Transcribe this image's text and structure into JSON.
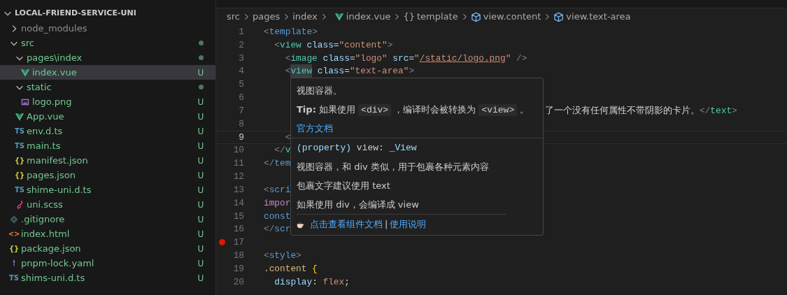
{
  "explorer": {
    "title": "LOCAL-FRIEND-SERVICE-UNI",
    "expanded": true,
    "tree": [
      {
        "label": "node_modules",
        "kind": "folder",
        "expanded": false,
        "dot": false,
        "ignored": true,
        "selected": false
      },
      {
        "label": "src",
        "kind": "folder",
        "expanded": true,
        "dot": true,
        "ignored": false,
        "selected": false,
        "children": [
          {
            "label": "pages\\index",
            "kind": "folder",
            "expanded": true,
            "dot": true,
            "ignored": false,
            "selected": false,
            "children": [
              {
                "label": "index.vue",
                "kind": "vue",
                "badge": "U",
                "ignored": false,
                "selected": true
              }
            ]
          },
          {
            "label": "static",
            "kind": "folder",
            "expanded": true,
            "dot": true,
            "ignored": false,
            "selected": false,
            "children": [
              {
                "label": "logo.png",
                "kind": "image",
                "badge": "U",
                "ignored": false,
                "selected": false
              }
            ]
          },
          {
            "label": "App.vue",
            "kind": "vue",
            "badge": "U",
            "ignored": false,
            "selected": false
          },
          {
            "label": "env.d.ts",
            "kind": "ts",
            "icon_label": "TS",
            "badge": "U",
            "ignored": false,
            "selected": false
          },
          {
            "label": "main.ts",
            "kind": "ts",
            "icon_label": "TS",
            "badge": "U",
            "ignored": false,
            "selected": false
          },
          {
            "label": "manifest.json",
            "kind": "json",
            "icon_label": "{}",
            "badge": "U",
            "ignored": false,
            "selected": false
          },
          {
            "label": "pages.json",
            "kind": "json",
            "icon_label": "{}",
            "badge": "U",
            "ignored": false,
            "selected": false
          },
          {
            "label": "shime-uni.d.ts",
            "kind": "ts",
            "icon_label": "TS",
            "badge": "U",
            "ignored": false,
            "selected": false
          },
          {
            "label": "uni.scss",
            "kind": "scss",
            "badge": "U",
            "ignored": false,
            "selected": false
          }
        ]
      },
      {
        "label": ".gitignore",
        "kind": "git",
        "badge": "U",
        "ignored": false,
        "selected": false
      },
      {
        "label": "index.html",
        "kind": "html",
        "icon_label": "<>",
        "badge": "U",
        "ignored": false,
        "selected": false
      },
      {
        "label": "package.json",
        "kind": "json",
        "icon_label": "{}",
        "badge": "U",
        "ignored": false,
        "selected": false
      },
      {
        "label": "pnpm-lock.yaml",
        "kind": "yaml",
        "icon_label": "!",
        "badge": "U",
        "ignored": false,
        "selected": false
      },
      {
        "label": "shims-uni.d.ts",
        "kind": "ts",
        "icon_label": "TS",
        "badge": "U",
        "ignored": false,
        "selected": false
      }
    ]
  },
  "breadcrumb": [
    {
      "label": "src",
      "kind": "plain"
    },
    {
      "label": "pages",
      "kind": "plain"
    },
    {
      "label": "index",
      "kind": "plain"
    },
    {
      "label": "index.vue",
      "kind": "vue"
    },
    {
      "label": "template",
      "kind": "braces",
      "icon_label": "{}"
    },
    {
      "label": "view.content",
      "kind": "element"
    },
    {
      "label": "view.text-area",
      "kind": "element"
    }
  ],
  "lines": [
    {
      "number": "1",
      "current": false,
      "breakpoint": false,
      "tokens": [
        {
          "text": "<",
          "kind": "punct"
        },
        {
          "text": "template",
          "kind": "tag"
        },
        {
          "text": ">",
          "kind": "punct"
        }
      ]
    },
    {
      "number": "2",
      "current": false,
      "breakpoint": false,
      "tokens": [
        {
          "text": "  <",
          "kind": "punct"
        },
        {
          "text": "view",
          "kind": "comp"
        },
        {
          "text": " class",
          "kind": "attr"
        },
        {
          "text": "=",
          "kind": "plain"
        },
        {
          "text": "\"content\"",
          "kind": "str"
        },
        {
          "text": ">",
          "kind": "punct"
        }
      ]
    },
    {
      "number": "3",
      "current": false,
      "breakpoint": false,
      "tokens": [
        {
          "text": "    <",
          "kind": "punct"
        },
        {
          "text": "image",
          "kind": "comp"
        },
        {
          "text": " class",
          "kind": "attr"
        },
        {
          "text": "=",
          "kind": "plain"
        },
        {
          "text": "\"logo\"",
          "kind": "str"
        },
        {
          "text": " src",
          "kind": "attr"
        },
        {
          "text": "=",
          "kind": "plain"
        },
        {
          "text": "\"",
          "kind": "str"
        },
        {
          "text": "/static/logo.png",
          "kind": "link"
        },
        {
          "text": "\"",
          "kind": "str"
        },
        {
          "text": " />",
          "kind": "punct"
        }
      ]
    },
    {
      "number": "4",
      "current": false,
      "breakpoint": false,
      "tokens": [
        {
          "text": "    <",
          "kind": "punct"
        },
        {
          "text": "view",
          "kind": "comp-hl"
        },
        {
          "text": " class",
          "kind": "attr"
        },
        {
          "text": "=",
          "kind": "plain"
        },
        {
          "text": "\"text-area\"",
          "kind": "str"
        },
        {
          "text": ">",
          "kind": "punct"
        }
      ]
    },
    {
      "number": "5",
      "current": false,
      "breakpoint": false
    },
    {
      "number": "6",
      "current": false,
      "breakpoint": false
    },
    {
      "number": "7",
      "current": false,
      "breakpoint": false,
      "after": [
        {
          "text": "了一个没有任何属性不带阴影的卡片。",
          "kind": "plain"
        },
        {
          "text": "</",
          "kind": "punct"
        },
        {
          "text": "text",
          "kind": "comp"
        },
        {
          "text": ">",
          "kind": "punct"
        }
      ]
    },
    {
      "number": "8",
      "current": false,
      "breakpoint": false
    },
    {
      "number": "9",
      "current": true,
      "breakpoint": false,
      "tokens": [
        {
          "text": "    <",
          "kind": "punct"
        }
      ]
    },
    {
      "number": "10",
      "current": false,
      "breakpoint": false,
      "tokens": [
        {
          "text": "  </",
          "kind": "punct"
        },
        {
          "text": "v",
          "kind": "comp"
        }
      ]
    },
    {
      "number": "11",
      "current": false,
      "breakpoint": false,
      "tokens": [
        {
          "text": "</",
          "kind": "punct"
        },
        {
          "text": "tem",
          "kind": "tag"
        }
      ]
    },
    {
      "number": "12",
      "current": false,
      "breakpoint": false
    },
    {
      "number": "13",
      "current": false,
      "breakpoint": false,
      "tokens": [
        {
          "text": "<",
          "kind": "punct"
        },
        {
          "text": "scri",
          "kind": "tag"
        }
      ]
    },
    {
      "number": "14",
      "current": false,
      "breakpoint": false,
      "tokens": [
        {
          "text": "impor",
          "kind": "keyword"
        }
      ]
    },
    {
      "number": "15",
      "current": false,
      "breakpoint": false,
      "tokens": [
        {
          "text": "const",
          "kind": "tag"
        }
      ]
    },
    {
      "number": "16",
      "current": false,
      "breakpoint": false,
      "tokens": [
        {
          "text": "</",
          "kind": "punct"
        },
        {
          "text": "scr",
          "kind": "tag"
        }
      ]
    },
    {
      "number": "17",
      "current": false,
      "breakpoint": true
    },
    {
      "number": "18",
      "current": false,
      "breakpoint": false,
      "tokens": [
        {
          "text": "<",
          "kind": "punct"
        },
        {
          "text": "style",
          "kind": "tag"
        },
        {
          "text": ">",
          "kind": "punct"
        }
      ]
    },
    {
      "number": "19",
      "current": false,
      "breakpoint": false,
      "tokens": [
        {
          "text": ".content",
          "kind": "selector"
        },
        {
          "text": " {",
          "kind": "brace"
        }
      ]
    },
    {
      "number": "20",
      "current": false,
      "breakpoint": false,
      "tokens": [
        {
          "text": "  display",
          "kind": "attr"
        },
        {
          "text": ": ",
          "kind": "plain"
        },
        {
          "text": "flex",
          "kind": "str"
        },
        {
          "text": ";",
          "kind": "plain"
        }
      ]
    }
  ],
  "hover": {
    "summary": "视图容器。",
    "tip": [
      {
        "text": "Tip:",
        "kind": "bold"
      },
      {
        "text": " 如果使用 ",
        "kind": "text"
      },
      {
        "text": "<div>",
        "kind": "code"
      },
      {
        "text": " ，编译时会被转换为 ",
        "kind": "text"
      },
      {
        "text": "<view>",
        "kind": "code"
      },
      {
        "text": " 。",
        "kind": "text"
      }
    ],
    "doc_link": "官方文档",
    "signature": [
      {
        "text": "(property)",
        "kind": "keyword"
      },
      {
        "text": " view: ",
        "kind": "plain"
      },
      {
        "text": "_View",
        "kind": "type"
      }
    ],
    "notes": [
      "视图容器，和 div 类似，用于包裹各种元素内容",
      "包裹文字建议使用 text",
      "如果使用 div，会编译成 view"
    ],
    "footer_links": [
      "点击查看组件文档",
      "使用说明"
    ],
    "footer_separator": "|"
  }
}
